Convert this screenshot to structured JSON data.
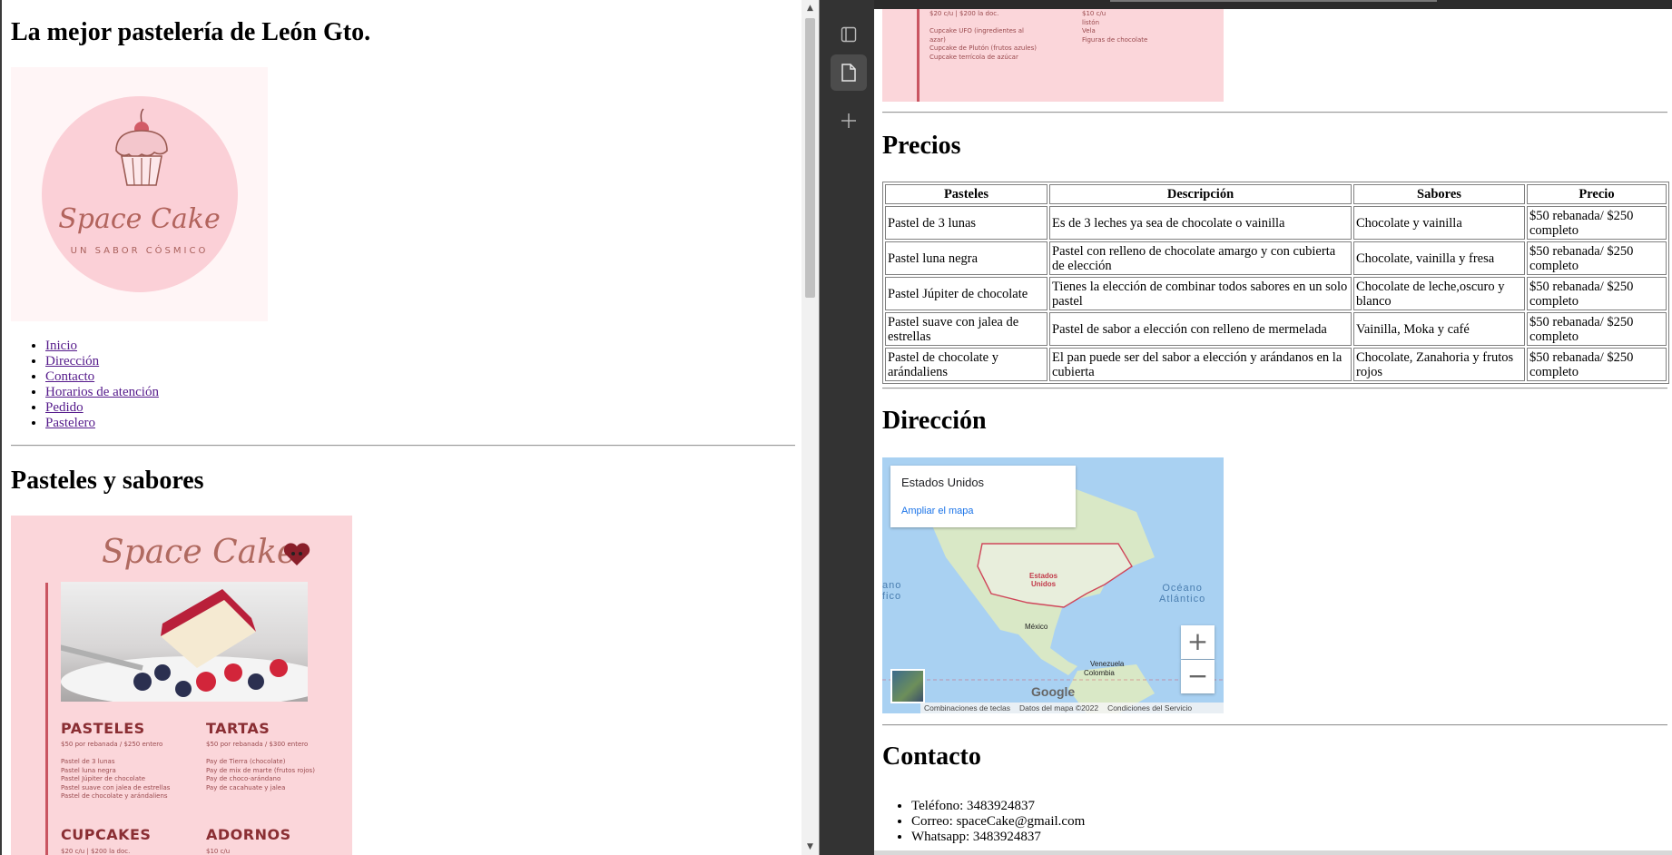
{
  "left_page": {
    "title": "La mejor pastelería de León Gto.",
    "logo": {
      "name": "Space Cake",
      "tagline": "UN SABOR CÓSMICO"
    },
    "nav": [
      "Inicio",
      "Dirección",
      "Contacto",
      "Horarios de atención",
      "Pedido",
      "Pastelero"
    ],
    "section_title": "Pasteles y sabores",
    "menu_image": {
      "title": "Space Cake",
      "sections": [
        {
          "heading": "PASTELES",
          "lines": "$50 por rebanada / $250 entero\n\nPastel de 3 lunas\nPastel luna negra\nPastel Júpiter de chocolate\nPastel suave con jalea de estrellas\nPastel de chocolate y arándaliens"
        },
        {
          "heading": "TARTAS",
          "lines": "$50 por rebanada / $300 entero\n\nPay de Tierra (chocolate)\nPay de mix de marte (frutos rojos)\nPay de choco-arándano\nPay de cacahuate y jalea"
        },
        {
          "heading": "CUPCAKES",
          "lines": "$20 c/u | $200 la doc."
        },
        {
          "heading": "ADORNOS",
          "lines": "$10 c/u"
        }
      ]
    }
  },
  "right_page": {
    "top_image_text": {
      "col1": "$20 c/u | $200 la doc.\n\nCupcake UFO (ingredientes al\nazar)\nCupcake de Plutón (frutos azules)\nCupcake terrícola de azúcar",
      "col2": "$10 c/u\nlistón\nVela\nFiguras de chocolate"
    },
    "prices_title": "Precios",
    "table": {
      "headers": [
        "Pasteles",
        "Descripción",
        "Sabores",
        "Precio"
      ],
      "rows": [
        [
          "Pastel de 3 lunas",
          "Es de 3 leches ya sea de chocolate o vainilla",
          "Chocolate y vainilla",
          "$50 rebanada/ $250 completo"
        ],
        [
          "Pastel luna negra",
          "Pastel con relleno de chocolate amargo y con cubierta de elección",
          "Chocolate, vainilla y fresa",
          "$50 rebanada/ $250 completo"
        ],
        [
          "Pastel Júpiter de chocolate",
          "Tienes la elección de combinar todos sabores en un solo pastel",
          "Chocolate de leche,oscuro y blanco",
          "$50 rebanada/ $250 completo"
        ],
        [
          "Pastel suave con jalea de estrellas",
          "Pastel de sabor a elección con relleno de mermelada",
          "Vainilla, Moka y café",
          "$50 rebanada/ $250 completo"
        ],
        [
          "Pastel de chocolate y arándaliens",
          "El pan puede ser del sabor a elección y arándanos en la cubierta",
          "Chocolate, Zanahoria y frutos rojos",
          "$50 rebanada/ $250 completo"
        ]
      ]
    },
    "address_title": "Dirección",
    "map": {
      "place": "Estados Unidos",
      "enlarge_link": "Ampliar el mapa",
      "labels": {
        "country": "Estados\nUnidos",
        "mexico": "México",
        "venezuela": "Venezuela",
        "colombia": "Colombia",
        "ocean": "Océano\nAtlántico",
        "ocean_left": "ano\nfico"
      },
      "zoom_in": "+",
      "zoom_out": "−",
      "brand": "Google",
      "footer": [
        "Combinaciones de teclas",
        "Datos del mapa ©2022",
        "Condiciones del Servicio"
      ]
    },
    "contact_title": "Contacto",
    "contact": [
      "Teléfono: 3483924837",
      "Correo: spaceCake@gmail.com",
      "Whatsapp: 3483924837"
    ]
  },
  "sidebar": {
    "icons": [
      "tab-layout-icon",
      "page-icon",
      "add-icon"
    ]
  },
  "colors": {
    "menu_bg": "#fbd6da",
    "menu_accent": "#c95561",
    "link_visited": "#551a8b",
    "sidebar_bg": "#333333"
  }
}
